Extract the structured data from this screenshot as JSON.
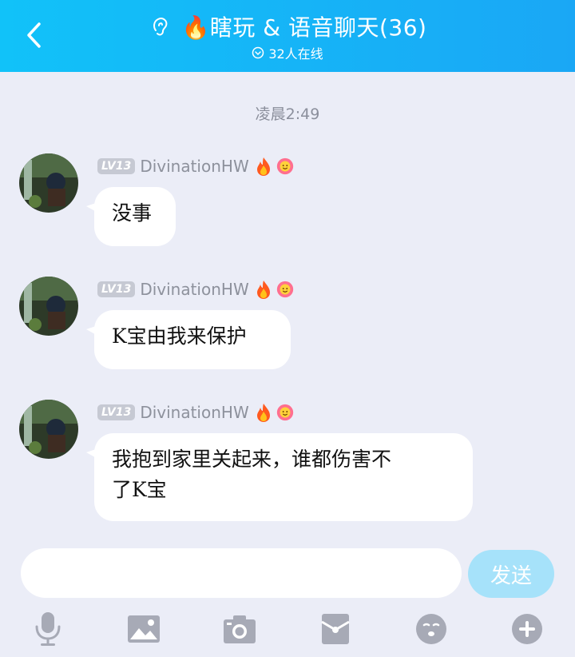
{
  "header": {
    "title": "🔥瞎玩 & 语音聊天(36)",
    "online": "32人在线",
    "accent": "#16b6f7"
  },
  "timestamp": "凌晨2:49",
  "messages": [
    {
      "level": "LV13",
      "nickname": "DivinationHW",
      "text": "没事"
    },
    {
      "level": "LV13",
      "nickname": "DivinationHW",
      "text": "K宝由我来保护"
    },
    {
      "level": "LV13",
      "nickname": "DivinationHW",
      "text_line1": "我抱到家里关起来，谁都伤害不",
      "text_line2": "了K宝"
    }
  ],
  "input": {
    "placeholder": "",
    "send_label": "发送"
  },
  "toolbar": [
    "microphone-icon",
    "image-icon",
    "camera-icon",
    "red-packet-icon",
    "emoji-icon",
    "plus-icon"
  ]
}
